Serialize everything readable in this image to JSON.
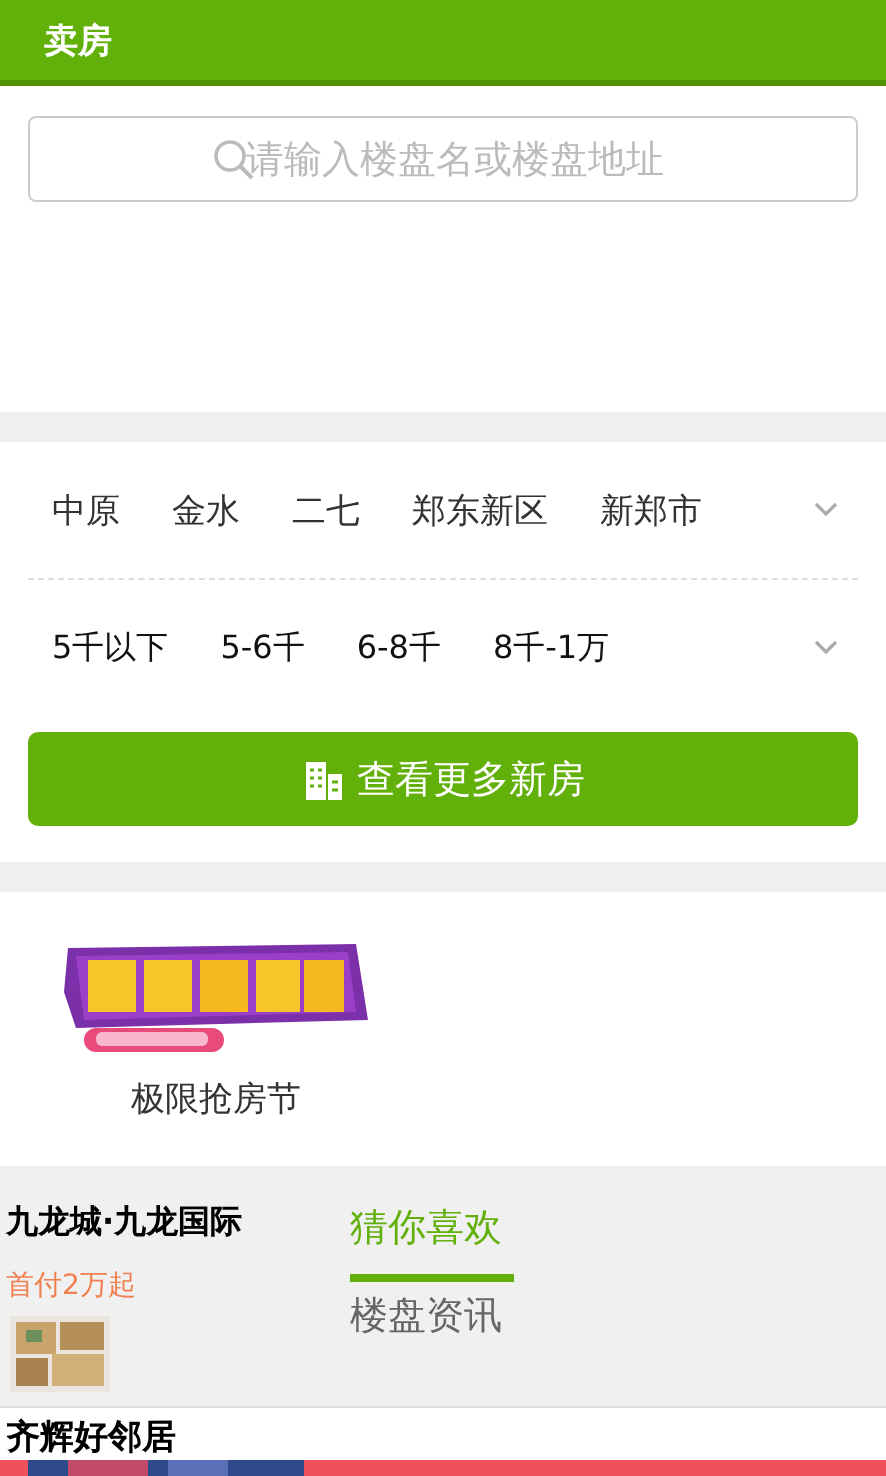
{
  "header": {
    "title": "卖房"
  },
  "search": {
    "placeholder": "请输入楼盘名或楼盘地址"
  },
  "districts": [
    "中原",
    "金水",
    "二七",
    "郑东新区",
    "新郑市"
  ],
  "prices": [
    "5千以下",
    "5-6千",
    "6-8千",
    "8千-1万"
  ],
  "more_button": "查看更多新房",
  "promo": {
    "label": "极限抢房节"
  },
  "listings": [
    {
      "name": "九龙城·九龙国际",
      "tag": "首付2万起"
    },
    {
      "name": "齐辉好邻居"
    }
  ],
  "tabs": [
    {
      "label": "猜你喜欢",
      "selected": true
    },
    {
      "label": "楼盘资讯",
      "selected": false
    }
  ]
}
